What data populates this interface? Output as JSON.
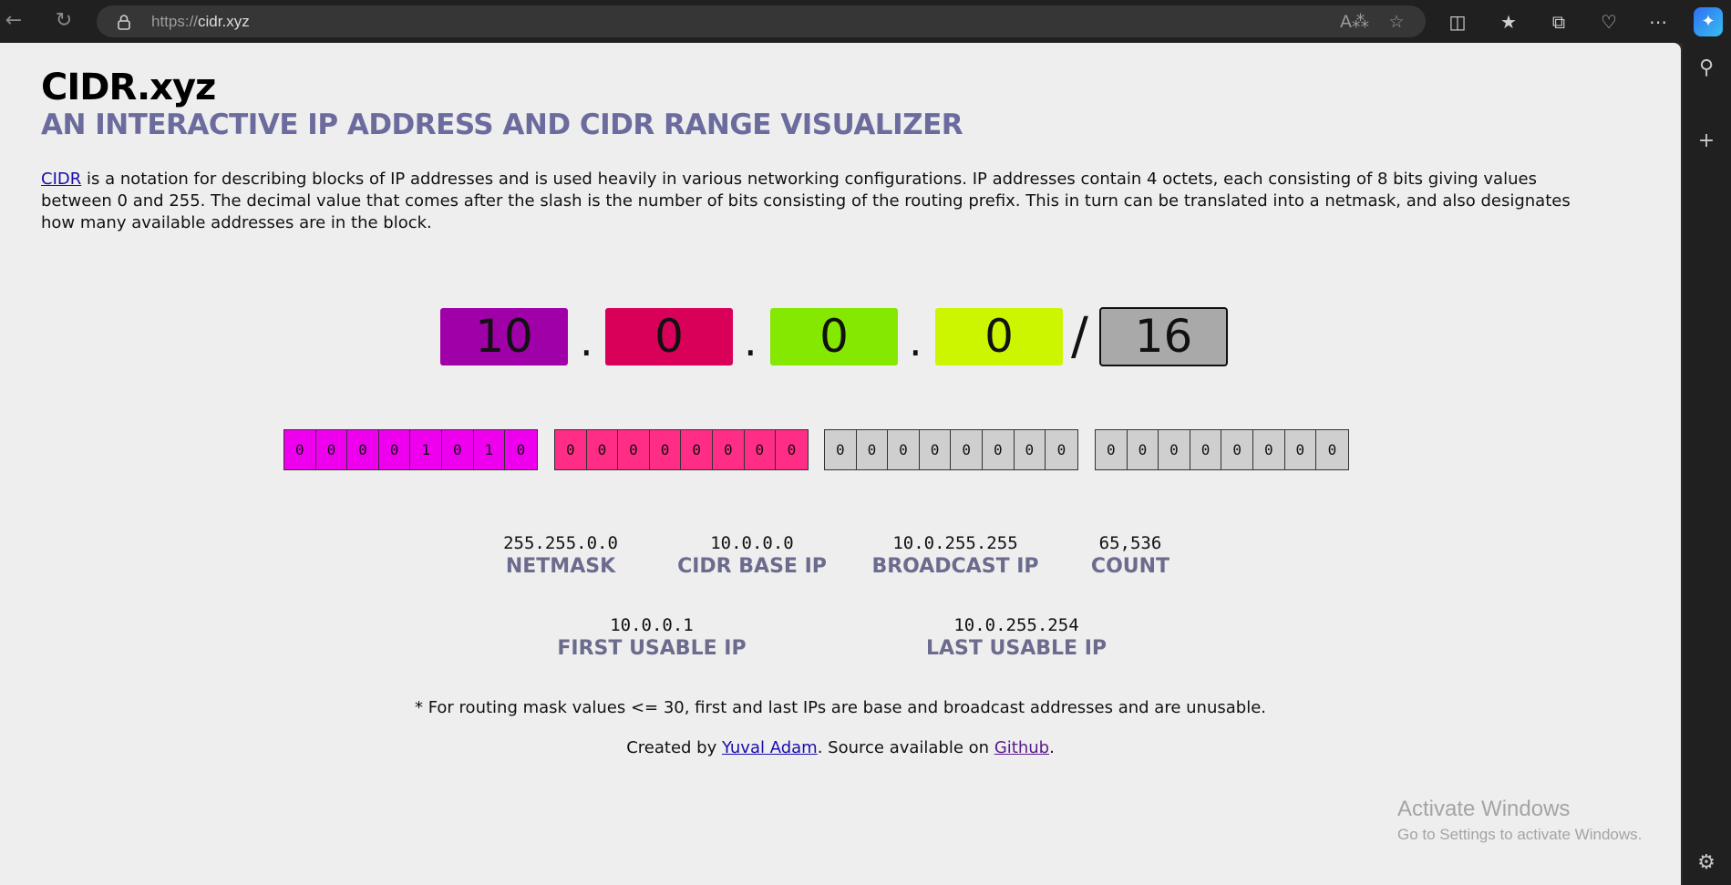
{
  "browser": {
    "url_protocol": "https://",
    "url_host": "cidr.xyz",
    "back_icon": "arrow-left",
    "refresh_icon": "refresh",
    "toolbar_icons": [
      "read-aloud",
      "favorite-star",
      "split-screen",
      "favorites",
      "collections",
      "browser-essentials",
      "more",
      "copilot"
    ]
  },
  "sidebar": {
    "icons": [
      "search",
      "add",
      "settings"
    ]
  },
  "page": {
    "title": "CIDR.xyz",
    "subtitle": "AN INTERACTIVE IP ADDRESS AND CIDR RANGE VISUALIZER",
    "intro_link": "CIDR",
    "intro_text": " is a notation for describing blocks of IP addresses and is used heavily in various networking configurations. IP addresses contain 4 octets, each consisting of 8 bits giving values between 0 and 255. The decimal value that comes after the slash is the number of bits consisting of the routing prefix. This in turn can be translated into a netmask, and also designates how many available addresses are in the block."
  },
  "ip": {
    "octets": [
      {
        "value": "10",
        "color": "#a000a8"
      },
      {
        "value": "0",
        "color": "#d9005a"
      },
      {
        "value": "0",
        "color": "#84e800"
      },
      {
        "value": "0",
        "color": "#ccf500"
      }
    ],
    "separator": ".",
    "slash": "/",
    "mask": "16",
    "mask_color": "#a9a9a9"
  },
  "bits": {
    "groups": [
      {
        "color": "#ee00ee",
        "bits": [
          "0",
          "0",
          "0",
          "0",
          "1",
          "0",
          "1",
          "0"
        ]
      },
      {
        "color": "#ff2d85",
        "bits": [
          "0",
          "0",
          "0",
          "0",
          "0",
          "0",
          "0",
          "0"
        ]
      },
      {
        "color": "#cfcfcf",
        "bits": [
          "0",
          "0",
          "0",
          "0",
          "0",
          "0",
          "0",
          "0"
        ]
      },
      {
        "color": "#cfcfcf",
        "bits": [
          "0",
          "0",
          "0",
          "0",
          "0",
          "0",
          "0",
          "0"
        ]
      }
    ]
  },
  "stats": {
    "netmask": {
      "value": "255.255.0.0",
      "label": "NETMASK"
    },
    "base_ip": {
      "value": "10.0.0.0",
      "label": "CIDR BASE IP"
    },
    "broadcast": {
      "value": "10.0.255.255",
      "label": "BROADCAST IP"
    },
    "count": {
      "value": "65,536",
      "label": "COUNT"
    },
    "first_usable": {
      "value": "10.0.0.1",
      "label": "FIRST USABLE IP"
    },
    "last_usable": {
      "value": "10.0.255.254",
      "label": "LAST USABLE IP"
    }
  },
  "footnote": "* For routing mask values <= 30, first and last IPs are base and broadcast addresses and are unusable.",
  "credits": {
    "prefix": "Created by ",
    "author": "Yuval Adam",
    "middle": ". Source available on ",
    "repo": "Github",
    "suffix": "."
  },
  "watermark": {
    "line1": "Activate Windows",
    "line2": "Go to Settings to activate Windows."
  }
}
